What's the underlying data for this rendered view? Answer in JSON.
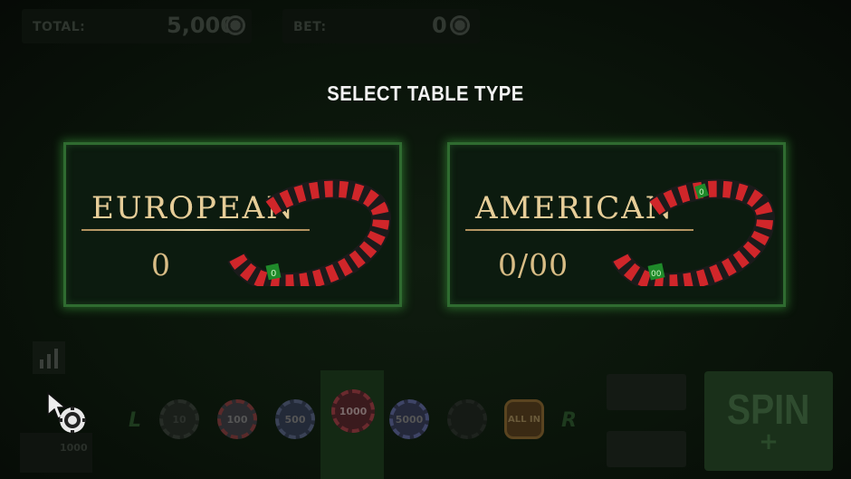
{
  "top_bar": {
    "total_label": "TOTAL:",
    "total_value": "5,000",
    "bet_label": "BET:",
    "bet_value": "0"
  },
  "dialog": {
    "title": "SELECT TABLE TYPE",
    "options": [
      {
        "name": "EUROPEAN",
        "sub": "0",
        "pocket_label": "0"
      },
      {
        "name": "AMERICAN",
        "sub": "0/00",
        "pocket_label": "00",
        "pocket_label_2": "0"
      }
    ]
  },
  "controls": {
    "left_arrow": "L",
    "right_arrow": "R",
    "chips": [
      "10",
      "100",
      "500",
      "1000",
      "5000",
      "",
      "ALL IN"
    ],
    "spin_label": "SPIN",
    "spin_plus": "+",
    "bottom_left_label": "1000"
  },
  "colors": {
    "background": "#0a140a",
    "card_border_glow": "#46be46",
    "gold_text": "#e6cd98",
    "wheel_red": "#d0262a",
    "wheel_black": "#1b1b1b",
    "pocket_green": "#1f8a2a"
  }
}
